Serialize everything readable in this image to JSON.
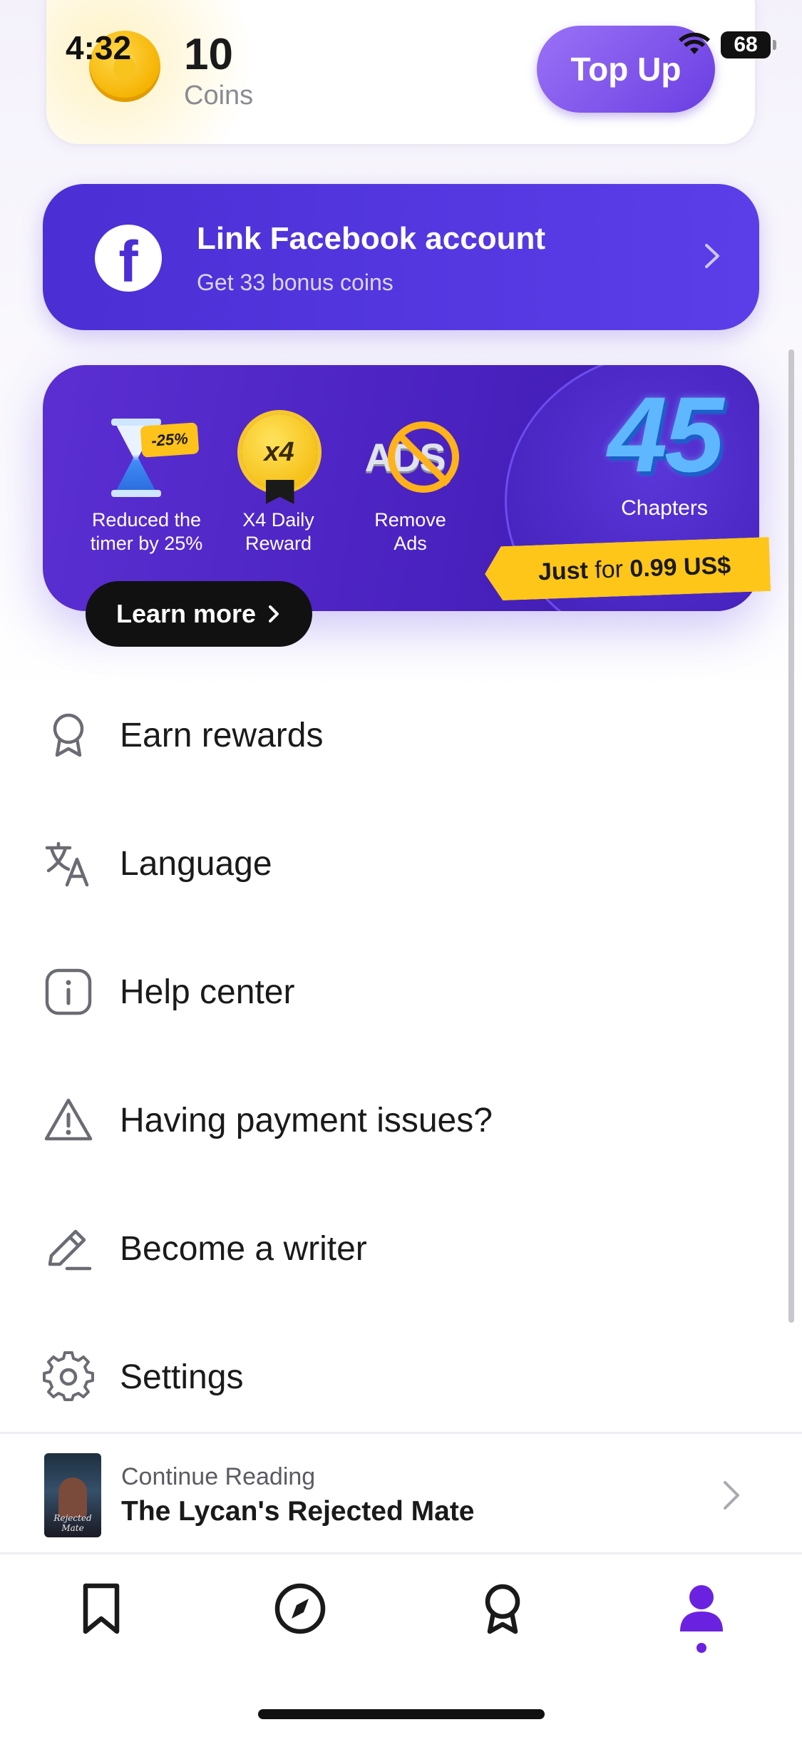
{
  "status_bar": {
    "time": "4:32",
    "battery": "68"
  },
  "coins_card": {
    "value": "10",
    "label": "Coins",
    "top_up_label": "Top Up"
  },
  "facebook_banner": {
    "title": "Link Facebook account",
    "subtitle": "Get 33 bonus coins",
    "icon": "facebook-icon"
  },
  "promo": {
    "benefits": [
      {
        "icon": "hourglass-icon",
        "tag": "-25%",
        "label_line1": "Reduced the",
        "label_line2": "timer by 25%"
      },
      {
        "icon": "x4-badge-icon",
        "tag": "x4",
        "label_line1": "X4 Daily",
        "label_line2": "Reward"
      },
      {
        "icon": "no-ads-icon",
        "tag": "ADS",
        "label_line1": "Remove",
        "label_line2": "Ads"
      }
    ],
    "chapters_number": "45",
    "chapters_label": "Chapters",
    "price_prefix": "Just",
    "price_for": "for",
    "price_value": "0.99 US$",
    "learn_more_label": "Learn more"
  },
  "menu": [
    {
      "label": "Earn rewards",
      "icon": "award-icon"
    },
    {
      "label": "Language",
      "icon": "translate-icon"
    },
    {
      "label": "Help center",
      "icon": "info-icon"
    },
    {
      "label": "Having payment issues?",
      "icon": "warning-icon"
    },
    {
      "label": "Become a writer",
      "icon": "pencil-icon"
    },
    {
      "label": "Settings",
      "icon": "gear-icon"
    }
  ],
  "continue_reading": {
    "label": "Continue Reading",
    "title": "The Lycan's Rejected Mate",
    "cover_text": "Rejected Mate"
  },
  "bottom_nav": [
    {
      "name": "library",
      "icon": "bookmark-icon",
      "active": false
    },
    {
      "name": "discover",
      "icon": "compass-icon",
      "active": false
    },
    {
      "name": "rewards",
      "icon": "award-icon",
      "active": false
    },
    {
      "name": "profile",
      "icon": "person-icon",
      "active": true
    }
  ],
  "colors": {
    "accent": "#5a3be6",
    "active_nav": "#6a22e0",
    "price_tag": "#ffc61a",
    "promo_bg": "#4a22c0"
  }
}
